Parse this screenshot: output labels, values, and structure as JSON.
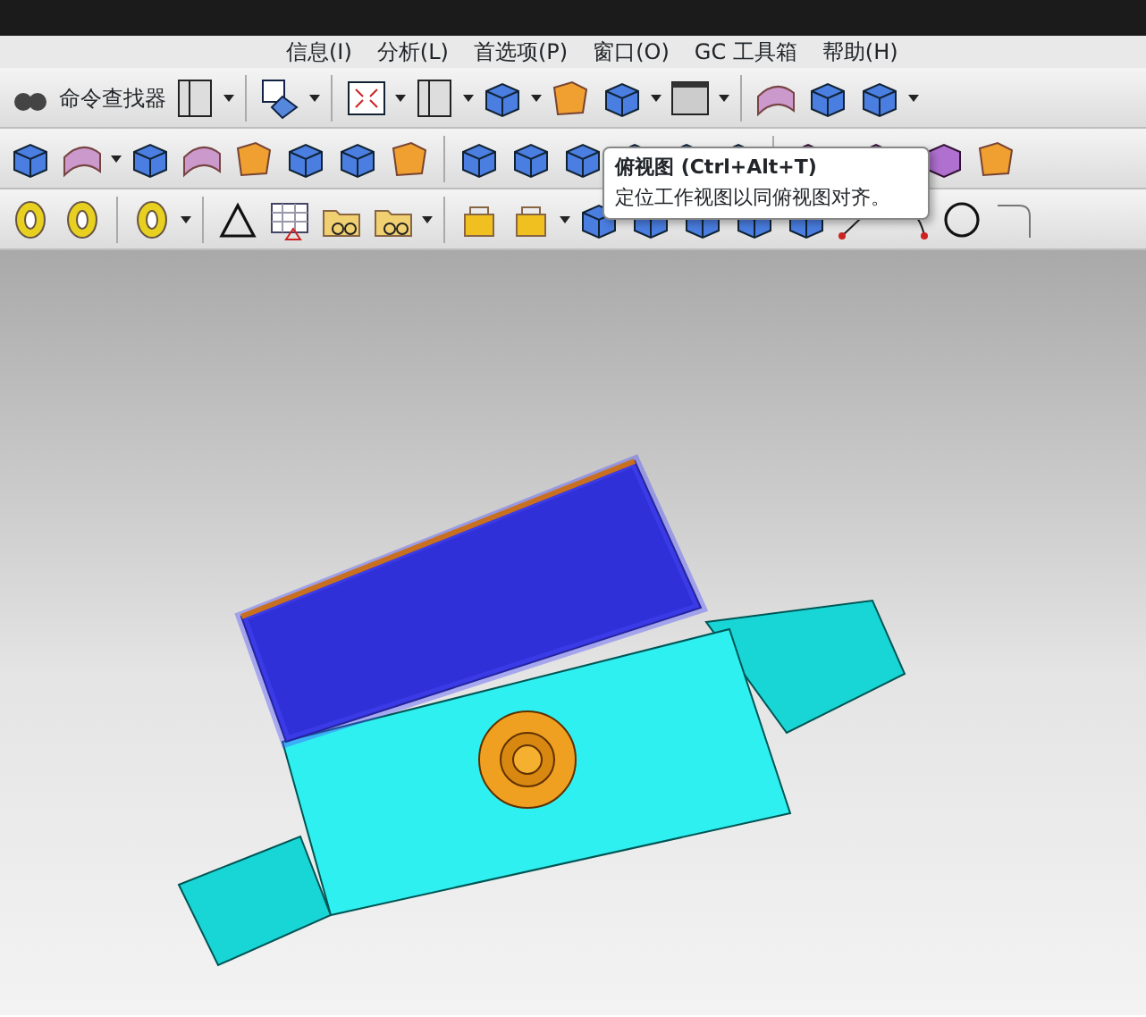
{
  "menu_bar": {
    "items": [
      "信息(I)",
      "分析(L)",
      "首选项(P)",
      "窗口(O)",
      "GC 工具箱",
      "帮助(H)"
    ]
  },
  "toolbar": {
    "command_finder": "命令查找器"
  },
  "tooltip": {
    "title": "俯视图 (Ctrl+Alt+T)",
    "description": "定位工作视图以同俯视图对齐。"
  }
}
